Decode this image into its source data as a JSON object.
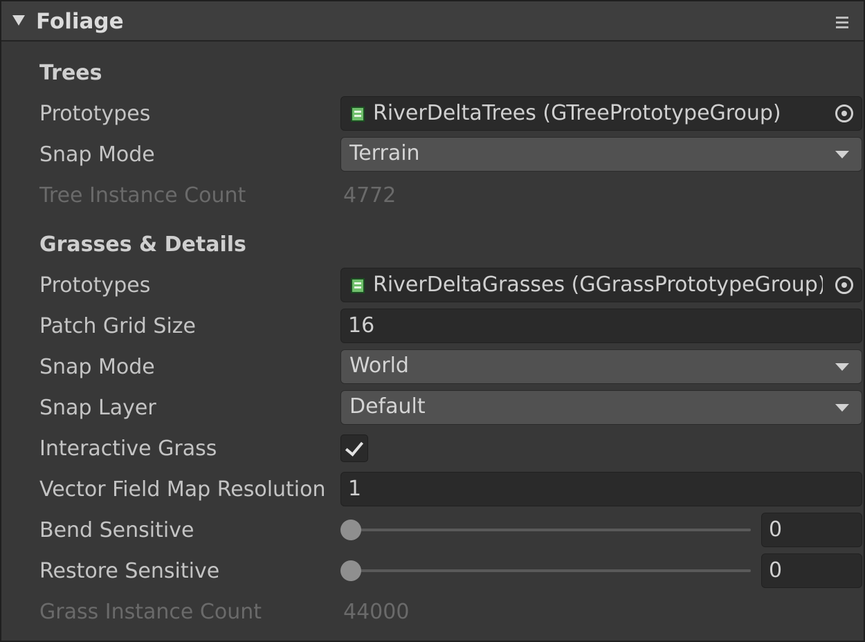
{
  "header": {
    "title": "Foliage",
    "fold_icon": "triangle-down-icon",
    "menu_icon": "hamburger-menu-icon"
  },
  "trees": {
    "section_label": "Trees",
    "prototypes_label": "Prototypes",
    "prototypes_value": "RiverDeltaTrees (GTreePrototypeGroup)",
    "snap_mode_label": "Snap Mode",
    "snap_mode_value": "Terrain",
    "instance_count_label": "Tree Instance Count",
    "instance_count_value": "4772"
  },
  "grasses": {
    "section_label": "Grasses & Details",
    "prototypes_label": "Prototypes",
    "prototypes_value": "RiverDeltaGrasses (GGrassPrototypeGroup)",
    "patch_grid_size_label": "Patch Grid Size",
    "patch_grid_size_value": "16",
    "snap_mode_label": "Snap Mode",
    "snap_mode_value": "World",
    "snap_layer_label": "Snap Layer",
    "snap_layer_value": "Default",
    "interactive_grass_label": "Interactive Grass",
    "interactive_grass_checked": true,
    "vector_field_label": "Vector Field Map Resolution",
    "vector_field_value": "1",
    "bend_sensitive_label": "Bend Sensitive",
    "bend_sensitive_value": "0",
    "bend_sensitive_fraction": 0,
    "restore_sensitive_label": "Restore Sensitive",
    "restore_sensitive_value": "0",
    "restore_sensitive_fraction": 0,
    "instance_count_label": "Grass Instance Count",
    "instance_count_value": "44000"
  },
  "icons": {
    "asset": "prototype-group-asset-icon",
    "picker": "object-picker-icon",
    "dropdown": "dropdown-arrow-icon",
    "check": "checkmark-icon"
  },
  "colors": {
    "panel_bg": "#383838",
    "field_bg": "#2a2a2a",
    "dropdown_bg": "#515151",
    "asset_icon": "#6fbf6b"
  }
}
